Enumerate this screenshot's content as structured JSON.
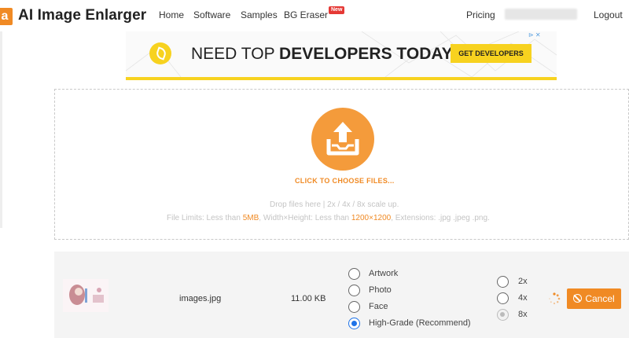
{
  "header": {
    "logo_mark": "a",
    "logo_text": "AI Image Enlarger",
    "nav": {
      "home": "Home",
      "software": "Software",
      "samples": "Samples",
      "bg_eraser": "BG Eraser",
      "new_badge": "New",
      "pricing": "Pricing",
      "logout": "Logout"
    }
  },
  "ad": {
    "headline_prefix": "NEED TOP ",
    "headline_bold": "DEVELOPERS TODAY?",
    "cta": "GET DEVELOPERS",
    "corner": "⊳ ✕",
    "accent_color": "#f7d21f"
  },
  "upload": {
    "choose_label": "CLICK TO CHOOSE FILES...",
    "drop_text": "Drop files here | 2x / 4x / 8x scale up.",
    "limits": {
      "prefix": "File Limits: Less than ",
      "size": "5MB",
      "middle": ", Width×Height: Less than ",
      "dimensions": "1200×1200",
      "suffix": ", Extensions: .jpg .jpeg .png."
    },
    "accent_color": "#f08a24"
  },
  "file": {
    "name": "images.jpg",
    "size": "11.00 KB",
    "types": [
      {
        "label": "Artwork",
        "checked": false
      },
      {
        "label": "Photo",
        "checked": false
      },
      {
        "label": "Face",
        "checked": false
      },
      {
        "label": "High-Grade (Recommend)",
        "checked": true
      }
    ],
    "scales": [
      {
        "label": "2x",
        "checked": false
      },
      {
        "label": "4x",
        "checked": false
      },
      {
        "label": "8x",
        "checked": true,
        "disabled": true
      }
    ],
    "cancel_label": "Cancel"
  }
}
